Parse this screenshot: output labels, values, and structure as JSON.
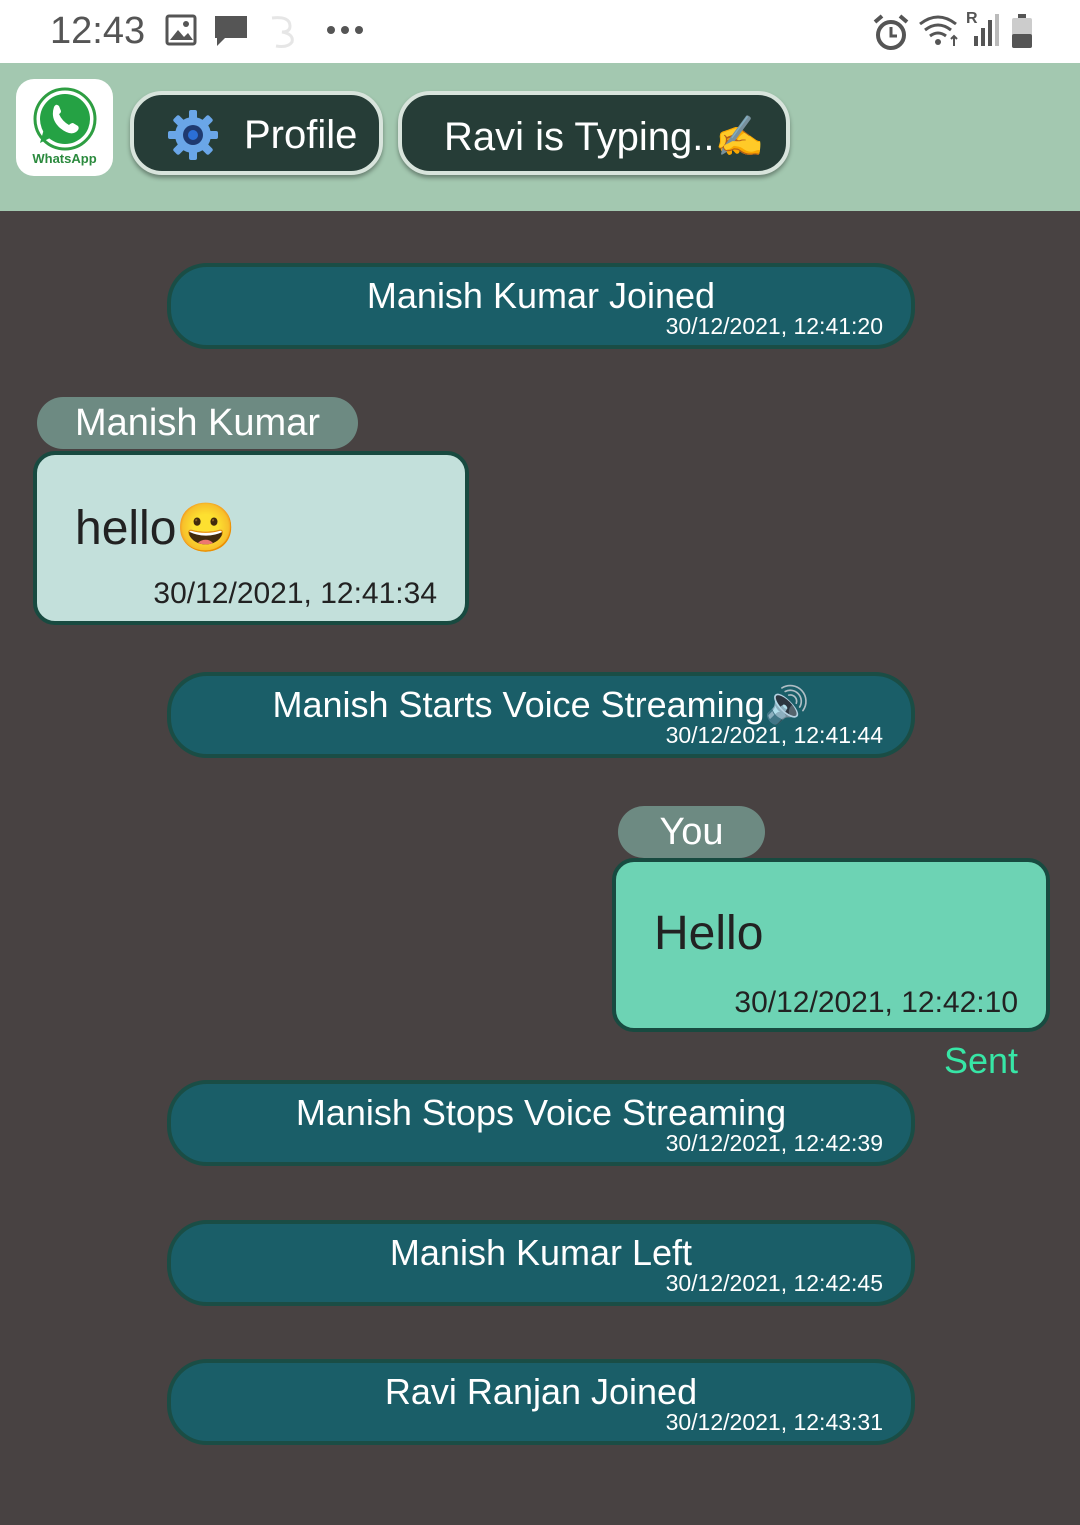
{
  "status_bar": {
    "time": "12:43",
    "icons": [
      "image-icon",
      "message-icon",
      "sync-icon",
      "more-icon",
      "alarm-icon",
      "wifi-icon",
      "signal-icon",
      "battery-icon"
    ],
    "roaming_label": "R"
  },
  "header": {
    "app_name": "WhatsApp",
    "profile_label": "Profile",
    "typing_label": "Ravi is Typing..✍️",
    "colors": {
      "header_bg": "#a3c8b0",
      "button_bg": "#263d37"
    }
  },
  "messages": [
    {
      "type": "system",
      "text": "Manish Kumar Joined",
      "time": "30/12/2021, 12:41:20"
    },
    {
      "type": "received",
      "sender": "Manish Kumar",
      "text": "hello😀",
      "time": "30/12/2021, 12:41:34"
    },
    {
      "type": "system",
      "text": "Manish Starts Voice Streaming🔊",
      "time": "30/12/2021, 12:41:44"
    },
    {
      "type": "sent",
      "sender": "You",
      "text": "Hello",
      "time": "30/12/2021, 12:42:10",
      "status": "Sent"
    },
    {
      "type": "system",
      "text": "Manish Stops Voice Streaming",
      "time": "30/12/2021, 12:42:39"
    },
    {
      "type": "system",
      "text": "Manish Kumar Left",
      "time": "30/12/2021, 12:42:45"
    },
    {
      "type": "system",
      "text": "Ravi Ranjan Joined",
      "time": "30/12/2021, 12:43:31"
    }
  ],
  "colors": {
    "chat_bg": "#484242",
    "system_bubble": "#1a5e68",
    "received_bubble": "#c3e0db",
    "sent_bubble": "#6dd3b4",
    "sent_status": "#37e6a6"
  }
}
